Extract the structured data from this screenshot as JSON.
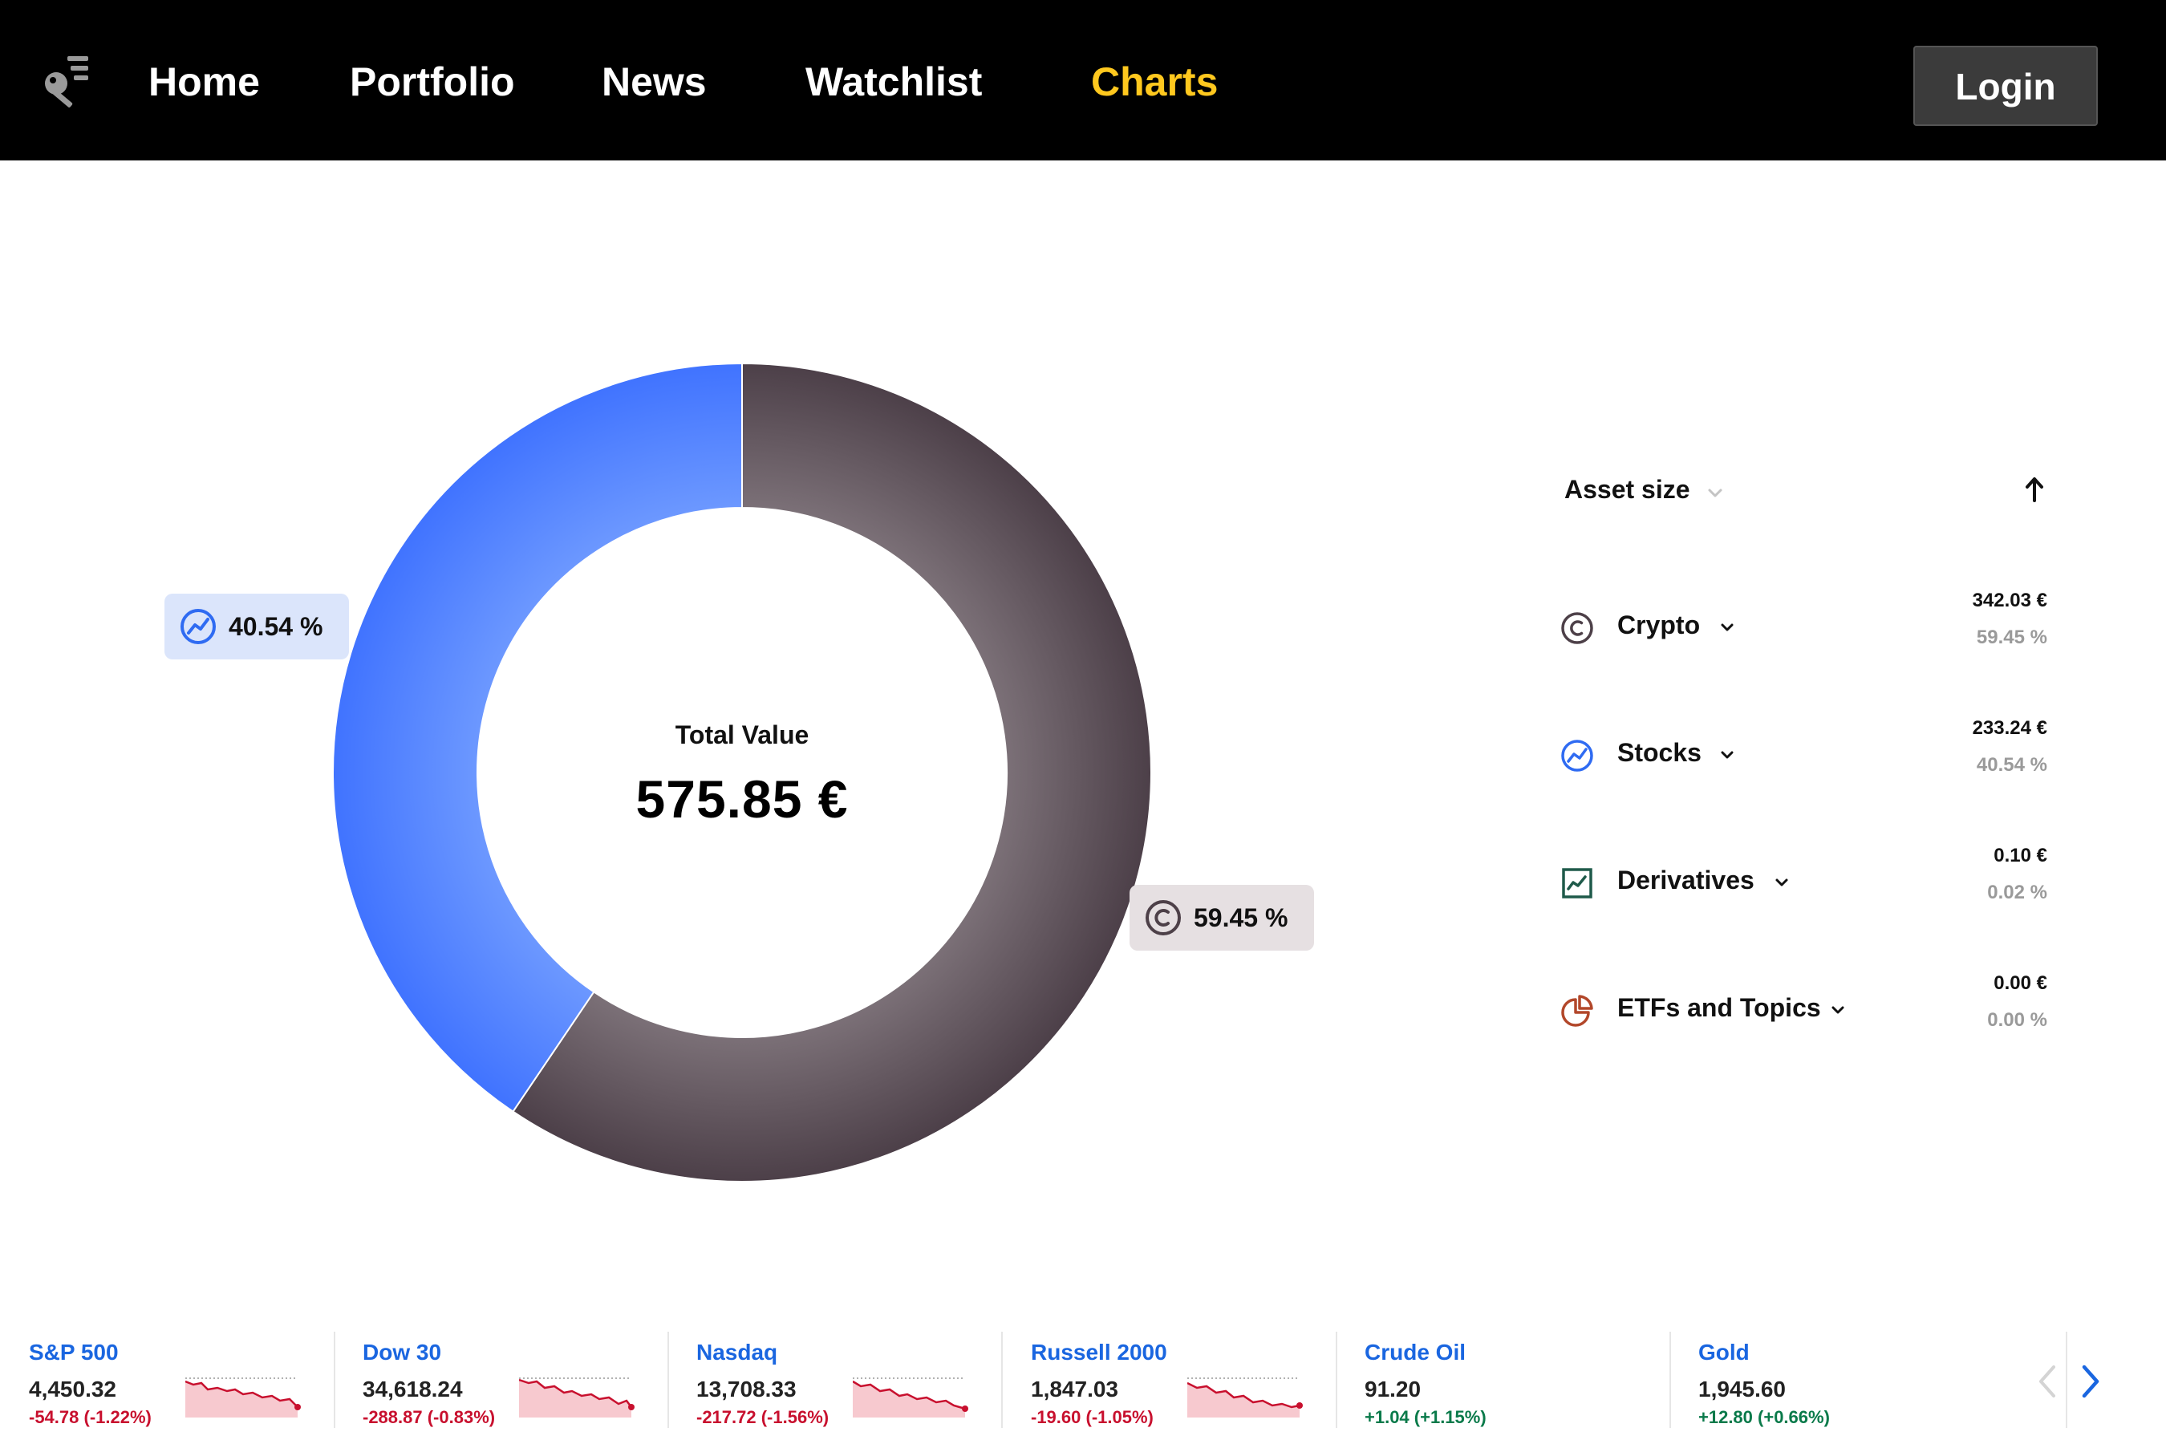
{
  "nav": {
    "items": [
      {
        "label": "Home",
        "active": false
      },
      {
        "label": "Portfolio",
        "active": false
      },
      {
        "label": "News",
        "active": false
      },
      {
        "label": "Watchlist",
        "active": false
      },
      {
        "label": "Charts",
        "active": true
      }
    ],
    "login_label": "Login"
  },
  "colors": {
    "nav_bg": "#000000",
    "nav_active": "#ffc81e",
    "stocks": "#4a7dff",
    "crypto": "#6b5e66",
    "derivatives": "#1f5a4a",
    "etfs": "#b2472a",
    "negative": "#c8102e",
    "positive": "#0a7a4a",
    "link": "#1a66e0"
  },
  "portfolio": {
    "total_label": "Total Value",
    "total_value": "575.85 €",
    "stocks_tag": "40.54 %",
    "crypto_tag": "59.45 %"
  },
  "chart_data": {
    "type": "pie",
    "categories": [
      "Crypto",
      "Stocks"
    ],
    "values": [
      59.45,
      40.54
    ]
  },
  "assets": {
    "sort_label": "Asset size",
    "sort_direction": "ascending-arrow",
    "rows": [
      {
        "name": "Crypto",
        "icon": "crypto-icon",
        "value": "342.03 €",
        "percent": "59.45 %"
      },
      {
        "name": "Stocks",
        "icon": "stocks-icon",
        "value": "233.24 €",
        "percent": "40.54 %"
      },
      {
        "name": "Derivatives",
        "icon": "derivatives-icon",
        "value": "0.10 €",
        "percent": "0.02 %"
      },
      {
        "name": "ETFs and Topics",
        "icon": "etfs-icon",
        "value": "0.00 €",
        "percent": "0.00 %"
      }
    ]
  },
  "ticker": [
    {
      "name": "S&P 500",
      "price": "4,450.32",
      "change": "-54.78 (-1.22%)",
      "direction": "down"
    },
    {
      "name": "Dow 30",
      "price": "34,618.24",
      "change": "-288.87 (-0.83%)",
      "direction": "down"
    },
    {
      "name": "Nasdaq",
      "price": "13,708.33",
      "change": "-217.72 (-1.56%)",
      "direction": "down"
    },
    {
      "name": "Russell 2000",
      "price": "1,847.03",
      "change": "-19.60 (-1.05%)",
      "direction": "down"
    },
    {
      "name": "Crude Oil",
      "price": "91.20",
      "change": "+1.04 (+1.15%)",
      "direction": "up"
    },
    {
      "name": "Gold",
      "price": "1,945.60",
      "change": "+12.80 (+0.66%)",
      "direction": "up"
    }
  ]
}
